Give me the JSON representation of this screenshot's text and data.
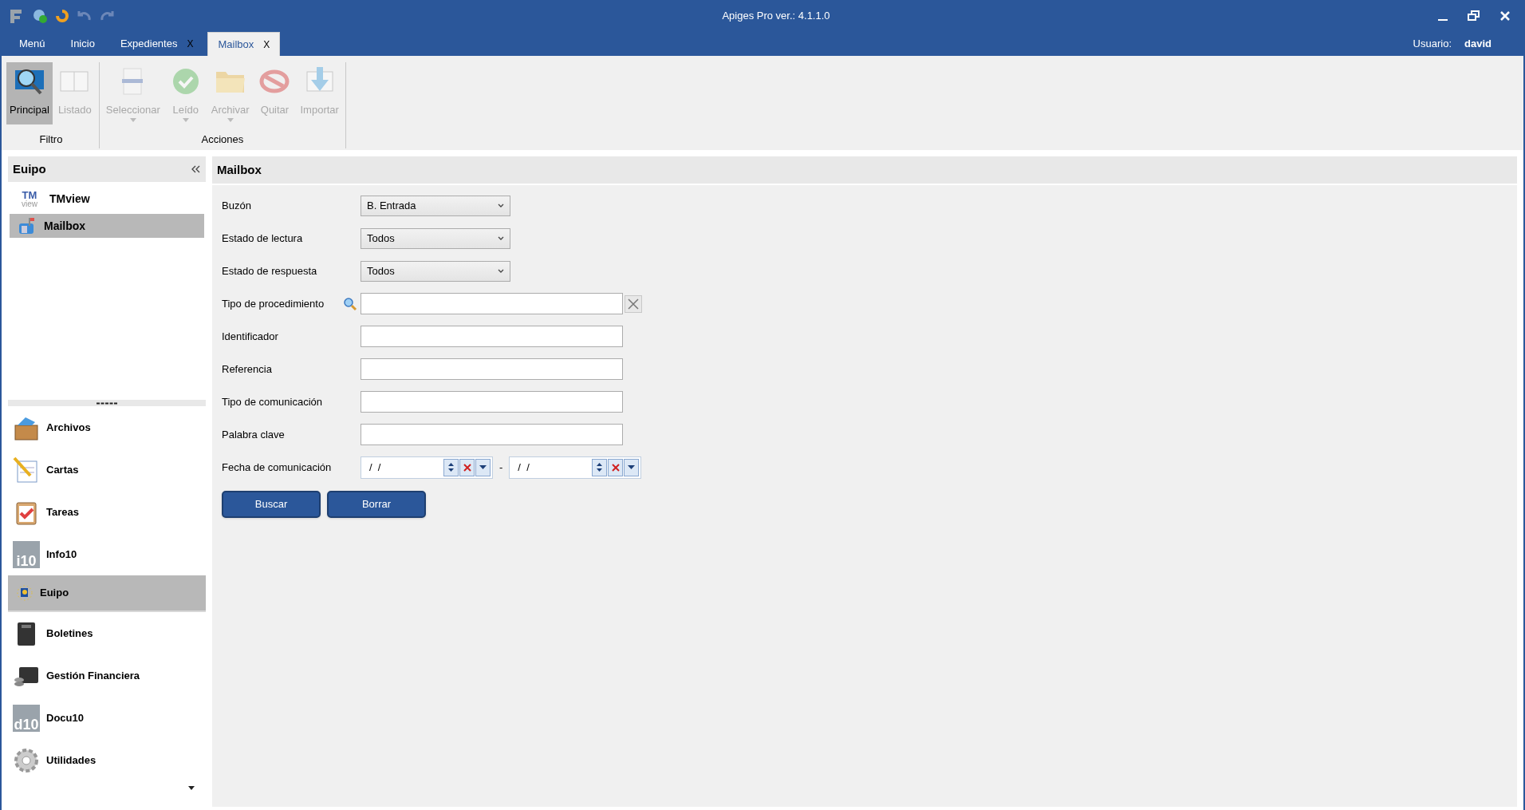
{
  "window": {
    "title": "Apiges Pro ver.: 4.1.1.0"
  },
  "tabs": [
    {
      "label": "Menú",
      "selected": false
    },
    {
      "label": "Inicio",
      "selected": false
    },
    {
      "label": "Expedientes",
      "close": "X",
      "selected": false
    },
    {
      "label": "Mailbox",
      "close": "X",
      "selected": true
    }
  ],
  "user": {
    "label": "Usuario:",
    "name": "david"
  },
  "ribbon": {
    "groups": [
      {
        "title": "Filtro",
        "buttons": [
          {
            "label": "Principal",
            "kind": "magnifier",
            "selected": true,
            "disabled": false,
            "dropdown": false
          },
          {
            "label": "Listado",
            "kind": "book",
            "selected": false,
            "disabled": true,
            "dropdown": false
          }
        ]
      },
      {
        "title": "Acciones",
        "buttons": [
          {
            "label": "Seleccionar",
            "kind": "list",
            "selected": false,
            "disabled": true,
            "dropdown": true
          },
          {
            "label": "Leído",
            "kind": "check",
            "selected": false,
            "disabled": true,
            "dropdown": true
          },
          {
            "label": "Archivar",
            "kind": "folder",
            "selected": false,
            "disabled": true,
            "dropdown": true
          },
          {
            "label": "Quitar",
            "kind": "forbidden",
            "selected": false,
            "disabled": true,
            "dropdown": false
          },
          {
            "label": "Importar",
            "kind": "import",
            "selected": false,
            "disabled": true,
            "dropdown": false
          }
        ]
      }
    ]
  },
  "sidebar": {
    "panel_title": "Euipo",
    "panel_items": [
      {
        "label": "TMview",
        "kind": "tmview",
        "logo": "TM",
        "logo_sub": "view",
        "selected": false
      },
      {
        "label": "Mailbox",
        "kind": "mailbox",
        "selected": true
      }
    ],
    "nav": [
      {
        "label": "Archivos",
        "kind": "crate",
        "selected": false
      },
      {
        "label": "Cartas",
        "kind": "notepad",
        "selected": false
      },
      {
        "label": "Tareas",
        "kind": "clipboard",
        "selected": false
      },
      {
        "label": "Info10",
        "kind": "info10",
        "logo": "i10",
        "selected": false
      },
      {
        "label": "Euipo",
        "kind": "euipo",
        "selected": true
      },
      {
        "label": "Boletines",
        "kind": "notebook",
        "selected": false
      },
      {
        "label": "Gestión Financiera",
        "kind": "wallet",
        "selected": false
      },
      {
        "label": "Docu10",
        "kind": "docu10",
        "logo": "d10",
        "selected": false
      },
      {
        "label": "Utilidades",
        "kind": "gear",
        "selected": false
      }
    ]
  },
  "form": {
    "title": "Mailbox",
    "fields": [
      {
        "label": "Buzón",
        "kind": "select",
        "value": "B. Entrada"
      },
      {
        "label": "Estado de lectura",
        "kind": "select",
        "value": "Todos"
      },
      {
        "label": "Estado de respuesta",
        "kind": "select",
        "value": "Todos"
      },
      {
        "label": "Tipo de procedimiento",
        "kind": "lookup"
      },
      {
        "label": "Identificador",
        "kind": "text"
      },
      {
        "label": "Referencia",
        "kind": "text"
      },
      {
        "label": "Tipo de comunicación",
        "kind": "text"
      },
      {
        "label": "Palabra clave",
        "kind": "text"
      },
      {
        "label": "Fecha de comunicación",
        "kind": "daterange",
        "from": "/  /",
        "separator": "-",
        "to": "/  /"
      }
    ],
    "buttons": [
      "Buscar",
      "Borrar"
    ]
  }
}
